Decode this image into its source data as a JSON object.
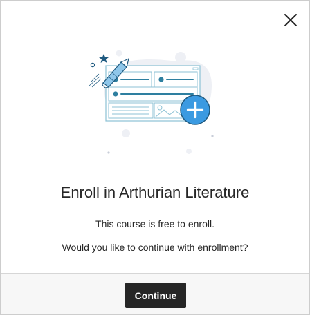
{
  "dialog": {
    "title": "Enroll in Arthurian Literature",
    "message_free": "This course is free to enroll.",
    "message_confirm": "Would you like to continue with enrollment?",
    "continue_label": "Continue"
  },
  "icons": {
    "close": "close-icon",
    "illustration": "enroll-illustration",
    "pencil": "pencil-icon",
    "plus": "plus-icon"
  },
  "colors": {
    "accent_blue": "#3b9ae1",
    "dark_button": "#262626",
    "footer_bg": "#f7f7f7",
    "illustration_teal": "#2e7fa0",
    "blob_gray": "#eef0f5"
  }
}
